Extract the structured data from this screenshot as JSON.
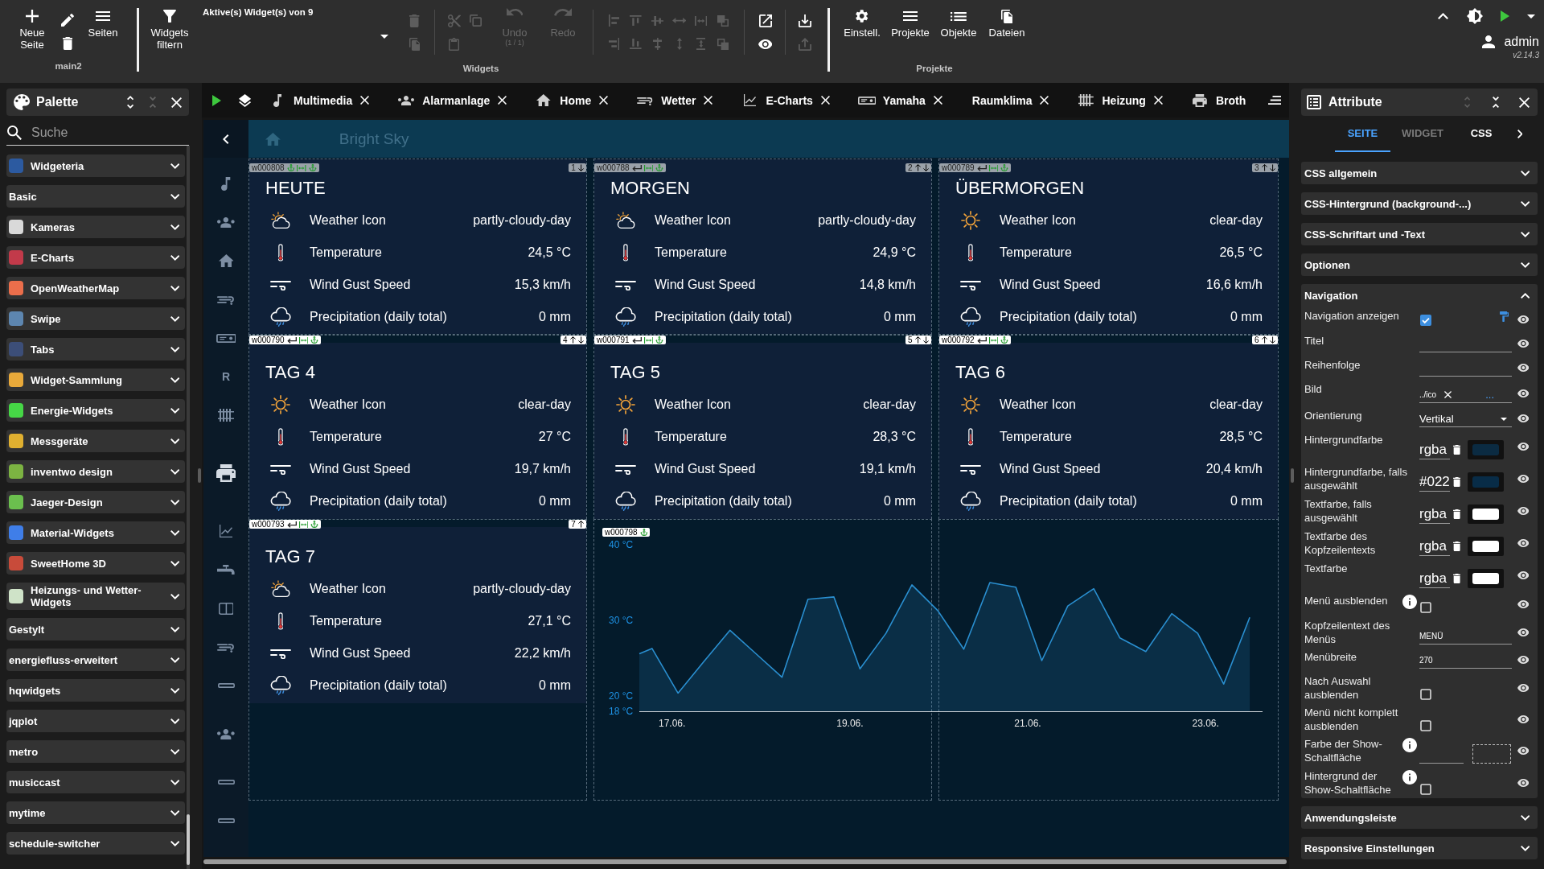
{
  "toolbar": {
    "new_page": "Neue Seite",
    "pages": "Seiten",
    "page_name": "main2",
    "filter": "Widgets filtern",
    "widget_select": "Aktive(s) Widget(s) von 9",
    "tool_groups": [
      {
        "tools": [
          {
            "kind": "delete",
            "disabled": true
          },
          {
            "kind": "copy",
            "disabled": true
          }
        ]
      },
      {
        "tools": [
          {
            "kind": "cut",
            "disabled": true
          },
          {
            "kind": "paste",
            "disabled": true
          },
          {
            "kind": "duplicate",
            "disabled": true
          }
        ]
      },
      {
        "tools": [
          {
            "kind": "align-left",
            "disabled": true
          },
          {
            "kind": "align-right",
            "disabled": true
          },
          {
            "kind": "align-top",
            "disabled": true
          },
          {
            "kind": "align-bottom",
            "disabled": true
          },
          {
            "kind": "center-vertical",
            "disabled": true
          },
          {
            "kind": "center-horizontal",
            "disabled": true
          },
          {
            "kind": "distribute-horizontal",
            "disabled": true
          },
          {
            "kind": "distribute-vertical",
            "disabled": true
          },
          {
            "kind": "same-width",
            "disabled": true
          },
          {
            "kind": "same-height",
            "disabled": true
          },
          {
            "kind": "bring-front",
            "disabled": true
          },
          {
            "kind": "send-back",
            "disabled": true
          }
        ]
      },
      {
        "tools": [
          {
            "kind": "open",
            "disabled": false
          },
          {
            "kind": "preview",
            "disabled": false
          }
        ]
      },
      {
        "tools": [
          {
            "kind": "import",
            "disabled": false
          },
          {
            "kind": "export",
            "disabled": true
          }
        ]
      }
    ],
    "undo": {
      "label": "Undo",
      "steps": "(1 / 1)",
      "disabled": true
    },
    "redo": {
      "label": "Redo",
      "disabled": true
    },
    "widgets_group": "Widgets",
    "project_buttons": [
      {
        "label": "Einstell.",
        "kind": "settings"
      },
      {
        "label": "Projekte",
        "kind": "projects"
      },
      {
        "label": "Objekte",
        "kind": "objects"
      },
      {
        "label": "Dateien",
        "kind": "files"
      }
    ],
    "projects_group": "Projekte",
    "user": "admin",
    "version": "v2.14.3"
  },
  "palette": {
    "title": "Palette",
    "search": {
      "placeholder": "Suche"
    },
    "items": [
      {
        "label": "Widgeteria",
        "color": "#2c5aa0",
        "expanded": false
      },
      {
        "label": "Basic",
        "expanded": false
      },
      {
        "label": "Kameras",
        "color": "#d9d9d9",
        "expanded": false
      },
      {
        "label": "E-Charts",
        "color": "#c23a4a",
        "expanded": false
      },
      {
        "label": "OpenWeatherMap",
        "color": "#eb6e4b",
        "expanded": false
      },
      {
        "label": "Swipe",
        "color": "#5d86b0",
        "expanded": false
      },
      {
        "label": "Tabs",
        "color": "#3c4e78",
        "expanded": false
      },
      {
        "label": "Widget-Sammlung",
        "color": "#e8a93a",
        "expanded": false
      },
      {
        "label": "Energie-Widgets",
        "color": "#46d646",
        "expanded": false
      },
      {
        "label": "Messgeräte",
        "color": "#e0b030",
        "expanded": false
      },
      {
        "label": "inventwo design",
        "color": "#7cb342",
        "expanded": false
      },
      {
        "label": "Jaeger-Design",
        "color": "#6bbf4e",
        "expanded": false
      },
      {
        "label": "Material-Widgets",
        "color": "#3f7ee8",
        "expanded": false
      },
      {
        "label": "SweetHome 3D",
        "color": "#c84b3a",
        "expanded": false
      },
      {
        "label": "Heizungs- und Wetter-Widgets",
        "color": "#cfe3c8",
        "expanded": false
      },
      {
        "label": "Gestylt",
        "expanded": false
      },
      {
        "label": "energiefluss-erweitert",
        "expanded": false
      },
      {
        "label": "hqwidgets",
        "expanded": false
      },
      {
        "label": "jqplot",
        "expanded": false
      },
      {
        "label": "metro",
        "expanded": false
      },
      {
        "label": "musiccast",
        "expanded": false
      },
      {
        "label": "mytime",
        "expanded": false
      },
      {
        "label": "schedule-switcher",
        "expanded": false
      }
    ]
  },
  "view_tabs": [
    {
      "label": "Multimedia",
      "kind": "music",
      "selected": false,
      "closable": true
    },
    {
      "label": "Alarmanlage",
      "kind": "alarm",
      "selected": false,
      "closable": true
    },
    {
      "label": "Home",
      "kind": "home",
      "selected": false,
      "closable": true
    },
    {
      "label": "Wetter",
      "kind": "weather",
      "selected": false,
      "closable": true
    },
    {
      "label": "E-Charts",
      "kind": "chart",
      "selected": false,
      "closable": true
    },
    {
      "label": "Yamaha",
      "kind": "receiver",
      "selected": false,
      "closable": true
    },
    {
      "label": "Raumklima",
      "kind": "plain",
      "selected": false,
      "closable": true
    },
    {
      "label": "Heizung",
      "kind": "radiator",
      "selected": false,
      "closable": true
    },
    {
      "label": "Broth",
      "kind": "printer",
      "selected": false,
      "closable": false
    }
  ],
  "nav": {
    "items": [
      {
        "kind": "music",
        "selected": false
      },
      {
        "kind": "alarm",
        "selected": false
      },
      {
        "kind": "home",
        "selected": false
      },
      {
        "kind": "weather",
        "selected": false
      },
      {
        "kind": "receiver",
        "selected": false
      },
      {
        "kind": "letter",
        "label": "R",
        "selected": false
      },
      {
        "kind": "radiator",
        "selected": false
      },
      {
        "kind": "printer",
        "selected": true
      },
      {
        "kind": "chart",
        "selected": false
      },
      {
        "kind": "faucet",
        "selected": false
      },
      {
        "kind": "panel",
        "selected": false
      },
      {
        "kind": "weather",
        "selected": false
      },
      {
        "kind": "dash",
        "selected": false
      },
      {
        "kind": "alarm",
        "selected": false
      },
      {
        "kind": "dash",
        "selected": false
      },
      {
        "kind": "dash",
        "selected": false
      }
    ]
  },
  "view": {
    "title": "Bright Sky"
  },
  "cards": [
    {
      "title": "HEUTE",
      "tags_faded": true,
      "tag": {
        "id": "w000808",
        "marks": [
          {
            "kind": "anchor"
          },
          {
            "kind": "width"
          },
          {
            "kind": "anchor"
          }
        ]
      },
      "order": {
        "label": "1",
        "up": false,
        "down": true
      },
      "rows": [
        {
          "kind": "partly-cloudy",
          "label": "Weather Icon",
          "value": "partly-cloudy-day"
        },
        {
          "kind": "temperature",
          "label": "Temperature",
          "value": "24,5 °C"
        },
        {
          "kind": "wind",
          "label": "Wind Gust Speed",
          "value": "15,3 km/h"
        },
        {
          "kind": "precipitation",
          "label": "Precipitation (daily total)",
          "value": "0 mm"
        }
      ]
    },
    {
      "title": "MORGEN",
      "tags_faded": true,
      "tag": {
        "id": "w000788",
        "marks": [
          {
            "kind": "return"
          },
          {
            "kind": "width"
          },
          {
            "kind": "anchor"
          }
        ]
      },
      "order": {
        "label": "2",
        "up": true,
        "down": true
      },
      "rows": [
        {
          "kind": "partly-cloudy",
          "label": "Weather Icon",
          "value": "partly-cloudy-day"
        },
        {
          "kind": "temperature",
          "label": "Temperature",
          "value": "24,9 °C"
        },
        {
          "kind": "wind",
          "label": "Wind Gust Speed",
          "value": "14,8 km/h"
        },
        {
          "kind": "precipitation",
          "label": "Precipitation (daily total)",
          "value": "0 mm"
        }
      ]
    },
    {
      "title": "ÜBERMORGEN",
      "tags_faded": true,
      "tag": {
        "id": "w000789",
        "marks": [
          {
            "kind": "return"
          },
          {
            "kind": "width"
          },
          {
            "kind": "anchor"
          }
        ]
      },
      "order": {
        "label": "3",
        "up": true,
        "down": true
      },
      "rows": [
        {
          "kind": "clear",
          "label": "Weather Icon",
          "value": "clear-day"
        },
        {
          "kind": "temperature",
          "label": "Temperature",
          "value": "26,5 °C"
        },
        {
          "kind": "wind",
          "label": "Wind Gust Speed",
          "value": "16,6 km/h"
        },
        {
          "kind": "precipitation",
          "label": "Precipitation (daily total)",
          "value": "0 mm"
        }
      ]
    },
    {
      "title": "TAG 4",
      "tags_faded": false,
      "tag": {
        "id": "w000790",
        "marks": [
          {
            "kind": "return"
          },
          {
            "kind": "width"
          },
          {
            "kind": "anchor"
          }
        ]
      },
      "order": {
        "label": "4",
        "up": true,
        "down": true
      },
      "rows": [
        {
          "kind": "clear",
          "label": "Weather Icon",
          "value": "clear-day"
        },
        {
          "kind": "temperature",
          "label": "Temperature",
          "value": "27 °C"
        },
        {
          "kind": "wind",
          "label": "Wind Gust Speed",
          "value": "19,7 km/h"
        },
        {
          "kind": "precipitation",
          "label": "Precipitation (daily total)",
          "value": "0 mm"
        }
      ]
    },
    {
      "title": "TAG 5",
      "tags_faded": false,
      "tag": {
        "id": "w000791",
        "marks": [
          {
            "kind": "return"
          },
          {
            "kind": "width"
          },
          {
            "kind": "anchor"
          }
        ]
      },
      "order": {
        "label": "5",
        "up": true,
        "down": true
      },
      "rows": [
        {
          "kind": "clear",
          "label": "Weather Icon",
          "value": "clear-day"
        },
        {
          "kind": "temperature",
          "label": "Temperature",
          "value": "28,3 °C"
        },
        {
          "kind": "wind",
          "label": "Wind Gust Speed",
          "value": "19,1 km/h"
        },
        {
          "kind": "precipitation",
          "label": "Precipitation (daily total)",
          "value": "0 mm"
        }
      ]
    },
    {
      "title": "TAG 6",
      "tags_faded": false,
      "tag": {
        "id": "w000792",
        "marks": [
          {
            "kind": "return"
          },
          {
            "kind": "width"
          },
          {
            "kind": "anchor"
          }
        ]
      },
      "order": {
        "label": "6",
        "up": true,
        "down": true
      },
      "rows": [
        {
          "kind": "clear",
          "label": "Weather Icon",
          "value": "clear-day"
        },
        {
          "kind": "temperature",
          "label": "Temperature",
          "value": "28,5 °C"
        },
        {
          "kind": "wind",
          "label": "Wind Gust Speed",
          "value": "20,4 km/h"
        },
        {
          "kind": "precipitation",
          "label": "Precipitation (daily total)",
          "value": "0 mm"
        }
      ]
    },
    {
      "title": "TAG 7",
      "tags_faded": false,
      "tag": {
        "id": "w000793",
        "marks": [
          {
            "kind": "return"
          },
          {
            "kind": "width"
          },
          {
            "kind": "anchor"
          }
        ]
      },
      "order": {
        "label": "7",
        "up": true,
        "down": false
      },
      "rows": [
        {
          "kind": "partly-cloudy",
          "label": "Weather Icon",
          "value": "partly-cloudy-day"
        },
        {
          "kind": "temperature",
          "label": "Temperature",
          "value": "27,1 °C"
        },
        {
          "kind": "wind",
          "label": "Wind Gust Speed",
          "value": "22,2 km/h"
        },
        {
          "kind": "precipitation",
          "label": "Precipitation (daily total)",
          "value": "0 mm"
        }
      ]
    }
  ],
  "chart": {
    "tag": {
      "id": "w000798",
      "marks": [
        {
          "kind": "anchor"
        }
      ]
    },
    "chart_data": {
      "type": "area",
      "x": [
        16.692,
        16.835,
        17.127,
        17.419,
        17.712,
        18.004,
        18.296,
        18.588,
        18.88,
        19.173,
        19.465,
        19.757,
        20.049,
        20.341,
        20.634,
        20.926,
        21.218,
        21.51,
        21.802,
        22.095,
        22.387,
        22.679,
        22.971,
        23.263,
        23.556
      ],
      "series": [
        {
          "color": "#2a8fd0",
          "values": [
            25.6,
            26.3,
            20.4,
            24.6,
            28.7,
            25.6,
            22.5,
            32.8,
            33.1,
            23.6,
            28.3,
            34.7,
            31.3,
            26.2,
            35.0,
            34.4,
            24.7,
            31.9,
            34.2,
            27.7,
            25.9,
            30.9,
            28.3,
            21.6,
            30.4
          ]
        }
      ],
      "xlim": [
        16.692,
        23.7
      ],
      "ylim": [
        18,
        40
      ],
      "xticks": [
        {
          "value": 17.06,
          "label": "17.06."
        },
        {
          "value": 19.06,
          "label": "19.06."
        },
        {
          "value": 21.06,
          "label": "21.06."
        },
        {
          "value": 23.06,
          "label": "23.06."
        }
      ],
      "yticks": [
        {
          "value": 18,
          "label": "18 °C"
        },
        {
          "value": 20,
          "label": "20 °C"
        },
        {
          "value": 30,
          "label": "30 °C"
        },
        {
          "value": 40,
          "label": "40 °C"
        }
      ]
    }
  },
  "attributes": {
    "title": "Attribute",
    "tabs": [
      {
        "label": "SEITE",
        "selected": true,
        "disabled": false
      },
      {
        "label": "WIDGET",
        "selected": false,
        "disabled": true
      },
      {
        "label": "CSS",
        "selected": false,
        "disabled": false
      }
    ],
    "sections": [
      {
        "label": "CSS allgemein",
        "expanded": false
      },
      {
        "label": "CSS-Hintergrund (background-...)",
        "expanded": false
      },
      {
        "label": "CSS-Schriftart und -Text",
        "expanded": false
      },
      {
        "label": "Optionen",
        "expanded": false
      },
      {
        "label": "Navigation",
        "expanded": true,
        "fields": [
          {
            "label": "Navigation anzeigen",
            "kind": "checkbox",
            "checked": true,
            "styled": true,
            "info": false
          },
          {
            "label": "Titel",
            "kind": "text",
            "styled": false,
            "info": false
          },
          {
            "label": "Reihenfolge",
            "kind": "text",
            "styled": false,
            "info": false
          },
          {
            "label": "Bild",
            "kind": "image",
            "value": "../ico",
            "button": "...",
            "styled": false,
            "info": false
          },
          {
            "label": "Orientierung",
            "kind": "select",
            "value": "Vertikal",
            "styled": false,
            "info": false
          },
          {
            "label": "Hintergrundfarbe",
            "kind": "color",
            "value": "rgba",
            "color": "#0b2b42",
            "styled": false,
            "info": false
          },
          {
            "label": "Hintergrundfarbe, falls ausgewählt",
            "kind": "color",
            "value": "#022",
            "color": "#082c47",
            "styled": false,
            "info": false
          },
          {
            "label": "Textfarbe, falls ausgewählt",
            "kind": "color",
            "value": "rgba",
            "color": "#ffffff",
            "styled": false,
            "info": false
          },
          {
            "label": "Textfarbe des Kopfzeilentexts",
            "kind": "color",
            "value": "rgba",
            "color": "#ffffff",
            "styled": false,
            "info": false
          },
          {
            "label": "Textfarbe",
            "kind": "color",
            "value": "rgba",
            "color": "#ffffff",
            "styled": false,
            "info": false
          },
          {
            "label": "Menü ausblenden",
            "kind": "checkbox",
            "checked": false,
            "styled": false,
            "info": true
          },
          {
            "label": "Kopfzeilentext des Menüs",
            "kind": "text",
            "value": "MENÜ",
            "styled": false,
            "info": false
          },
          {
            "label": "Menübreite",
            "kind": "text",
            "value": "270",
            "styled": false,
            "info": false
          },
          {
            "label": "Nach Auswahl ausblenden",
            "kind": "checkbox",
            "checked": false,
            "styled": false,
            "info": false
          },
          {
            "label": "Menü nicht komplett ausblenden",
            "kind": "checkbox",
            "checked": false,
            "styled": false,
            "info": false
          },
          {
            "label": "Farbe der Show-Schaltfläche",
            "kind": "color",
            "styled": false,
            "info": true
          },
          {
            "label": "Hintergrund der Show-Schaltfläche",
            "kind": "checkbox",
            "checked": false,
            "styled": false,
            "info": true
          }
        ]
      },
      {
        "label": "Anwendungsleiste",
        "expanded": false
      },
      {
        "label": "Responsive Einstellungen",
        "expanded": false
      }
    ]
  }
}
